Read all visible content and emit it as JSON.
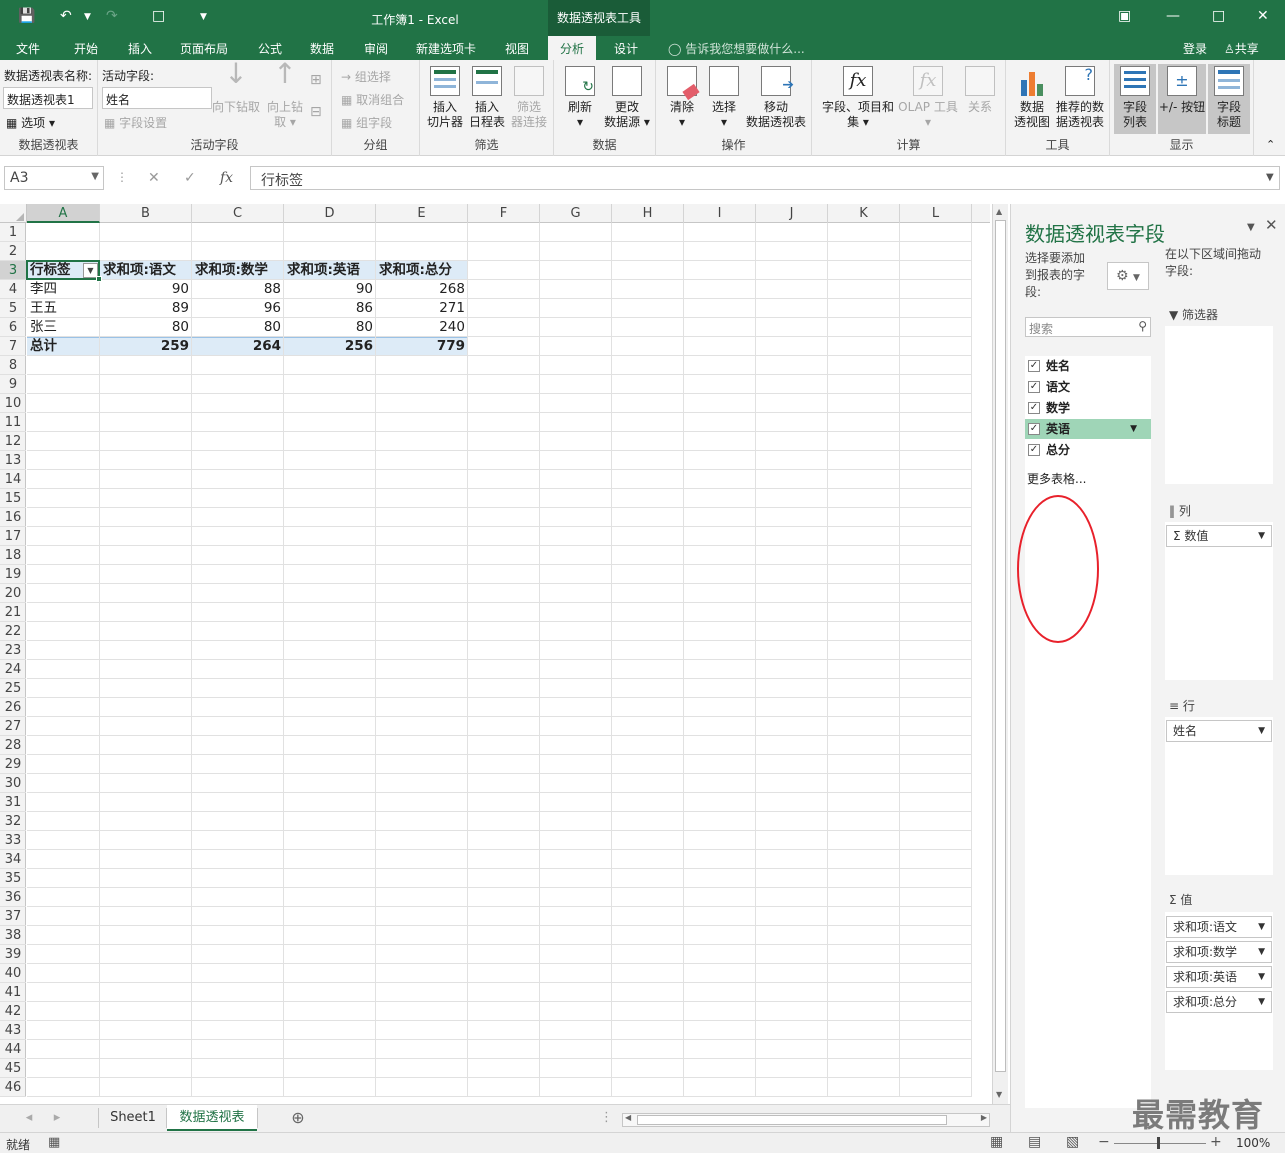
{
  "titlebar": {
    "title": "工作簿1 - Excel",
    "context_tab": "数据透视表工具",
    "save_icon": "save-icon",
    "undo_icon": "undo-icon",
    "redo_icon": "redo-icon"
  },
  "tabs": [
    "文件",
    "开始",
    "插入",
    "页面布局",
    "公式",
    "数据",
    "审阅",
    "新建选项卡",
    "视图",
    "分析",
    "设计"
  ],
  "active_tab": "分析",
  "tell_me": "告诉我您想要做什么...",
  "login": "登录",
  "share": "共享",
  "ribbon": {
    "pt_name_label": "数据透视表名称:",
    "pt_name_value": "数据透视表1",
    "options_btn": "选项",
    "group_pt": "数据透视表",
    "active_field_label": "活动字段:",
    "active_field_value": "姓名",
    "field_settings": "字段设置",
    "drill_down": "向下钻取",
    "drill_up_1": "向上钻",
    "drill_up_2": "取",
    "group_active": "活动字段",
    "grp_select": "组选择",
    "ungroup": "取消组合",
    "grp_field": "组字段",
    "group_group": "分组",
    "insert_slicer_1": "插入",
    "insert_slicer_2": "切片器",
    "insert_timeline_1": "插入",
    "insert_timeline_2": "日程表",
    "filter_conn_1": "筛选",
    "filter_conn_2": "器连接",
    "group_filter": "筛选",
    "refresh": "刷新",
    "change_src_1": "更改",
    "change_src_2": "数据源",
    "group_data": "数据",
    "clear": "清除",
    "select": "选择",
    "move_1": "移动",
    "move_2": "数据透视表",
    "group_actions": "操作",
    "fields_items_1": "字段、项目和",
    "fields_items_2": "集",
    "olap": "OLAP 工具",
    "relations": "关系",
    "group_calc": "计算",
    "pivot_chart_1": "数据",
    "pivot_chart_2": "透视图",
    "recommended_1": "推荐的数",
    "recommended_2": "据透视表",
    "group_tools": "工具",
    "field_list_1": "字段",
    "field_list_2": "列表",
    "plus_minus": "+/- 按钮",
    "field_headers_1": "字段",
    "field_headers_2": "标题",
    "group_show": "显示"
  },
  "formula_bar": {
    "name_box": "A3",
    "formula": "行标签",
    "fx": "fx"
  },
  "columns": [
    "A",
    "B",
    "C",
    "D",
    "E",
    "F",
    "G",
    "H",
    "I",
    "J",
    "K",
    "L"
  ],
  "rows": [
    "1",
    "2",
    "3",
    "4",
    "5",
    "6",
    "7",
    "8",
    "9",
    "10",
    "11",
    "12",
    "13",
    "14",
    "15",
    "16",
    "17",
    "18",
    "19",
    "20",
    "21",
    "22",
    "23",
    "24",
    "25",
    "26",
    "27",
    "28",
    "29",
    "30",
    "31",
    "32",
    "33",
    "34",
    "35",
    "36",
    "37",
    "38",
    "39",
    "40",
    "41",
    "42",
    "43",
    "44",
    "45",
    "46"
  ],
  "pivot": {
    "headers": [
      "行标签",
      "求和项:语文",
      "求和项:数学",
      "求和项:英语",
      "求和项:总分"
    ],
    "rows": [
      [
        "李四",
        "90",
        "88",
        "90",
        "268"
      ],
      [
        "王五",
        "89",
        "96",
        "86",
        "271"
      ],
      [
        "张三",
        "80",
        "80",
        "80",
        "240"
      ]
    ],
    "total": [
      "总计",
      "259",
      "264",
      "256",
      "779"
    ]
  },
  "sheets": [
    "Sheet1",
    "数据透视表"
  ],
  "active_sheet": "数据透视表",
  "status": {
    "ready": "就绪",
    "zoom": "100%"
  },
  "pane": {
    "title": "数据透视表字段",
    "choose_1": "选择要添加",
    "choose_2": "到报表的字",
    "choose_3": "段:",
    "drag_1": "在以下区域间拖动",
    "drag_2": "字段:",
    "search_placeholder": "搜索",
    "fields": [
      "姓名",
      "语文",
      "数学",
      "英语",
      "总分"
    ],
    "more_tables": "更多表格...",
    "filters_label": "筛选器",
    "columns_label": "列",
    "columns_chip": "数值",
    "rows_label": "行",
    "rows_chip": "姓名",
    "values_label": "值",
    "values_chips": [
      "求和项:语文",
      "求和项:数学",
      "求和项:英语",
      "求和项:总分"
    ]
  },
  "watermark": "最需教育"
}
